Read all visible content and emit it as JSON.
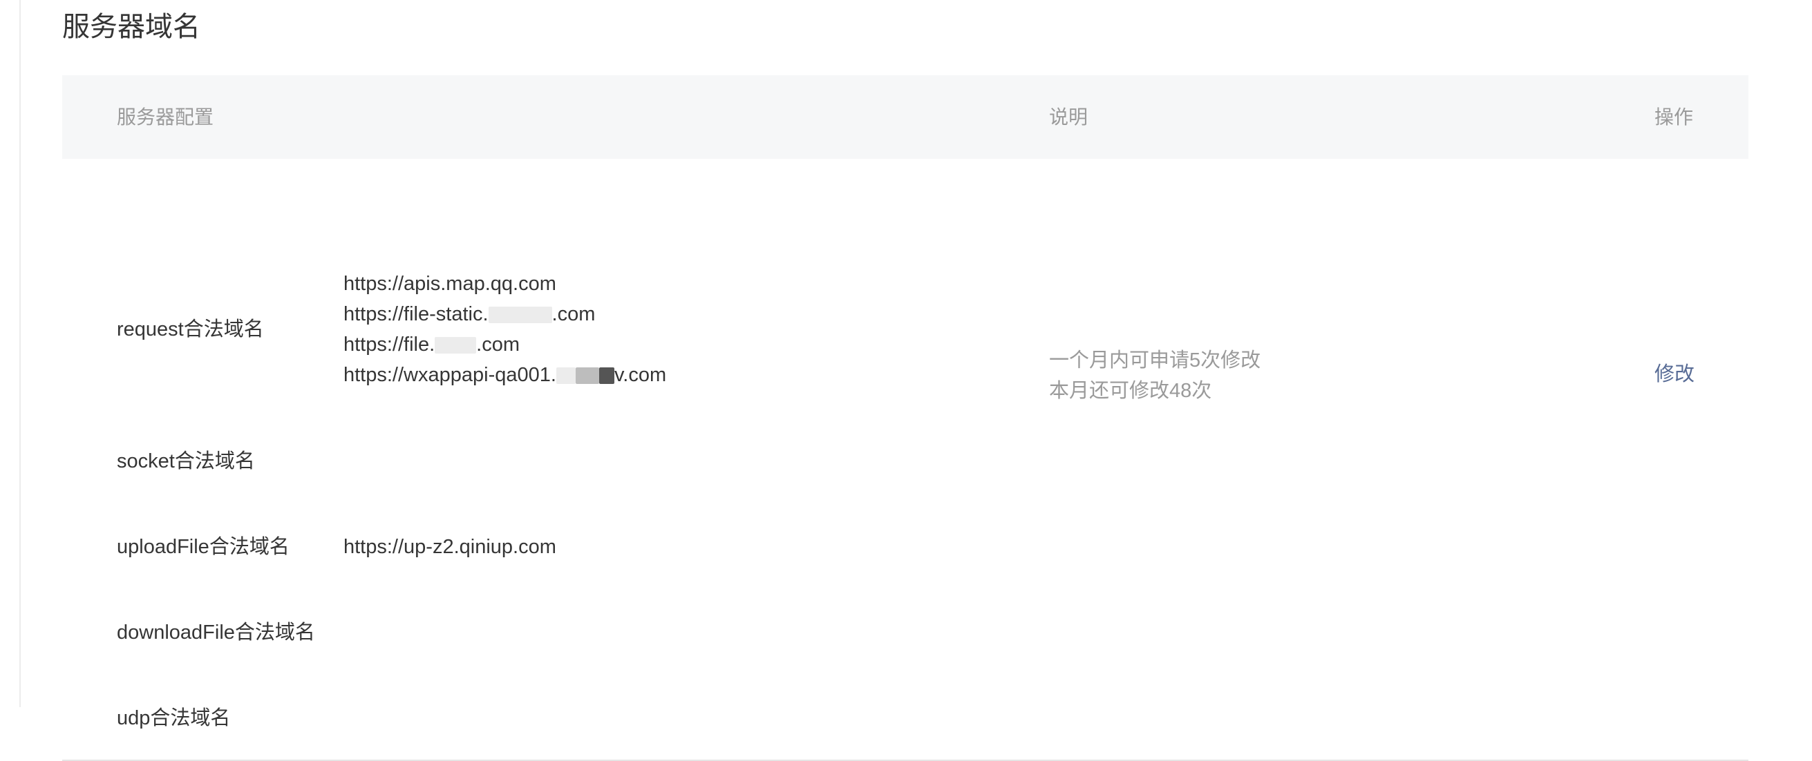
{
  "section": {
    "title": "服务器域名"
  },
  "table": {
    "headers": {
      "config": "服务器配置",
      "description": "说明",
      "operation": "操作"
    },
    "rows": [
      {
        "label": "request合法域名",
        "urls": [
          {
            "prefix": "https://apis.map.qq.com",
            "suffix": ""
          },
          {
            "prefix": "https://file-static.",
            "suffix": ".com"
          },
          {
            "prefix": "https://file.",
            "suffix": ".com"
          },
          {
            "prefix": "https://wxappapi-qa001.",
            "suffix": "v.com"
          }
        ]
      },
      {
        "label": "socket合法域名",
        "urls": []
      },
      {
        "label": "uploadFile合法域名",
        "urls": [
          {
            "prefix": "https://up-z2.qiniup.com",
            "suffix": ""
          }
        ]
      },
      {
        "label": "downloadFile合法域名",
        "urls": []
      },
      {
        "label": "udp合法域名",
        "urls": []
      }
    ],
    "description": {
      "line1": "一个月内可申请5次修改",
      "line2": "本月还可修改48次"
    },
    "operation_label": "修改"
  },
  "colors": {
    "link": "#576b95",
    "header_bg": "#f6f7f8",
    "muted_text": "#9a9a9a",
    "body_text": "#353535"
  }
}
